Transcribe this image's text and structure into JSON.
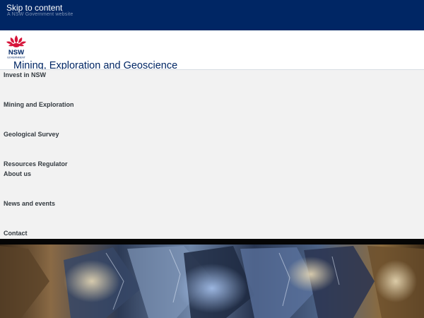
{
  "topbar": {
    "gov_text": "A NSW Government website",
    "skip_link": "Skip to content"
  },
  "header": {
    "logo_text": "NSW",
    "logo_subtext": "GOVERNMENT",
    "site_title": "Mining, Exploration and Geoscience"
  },
  "nav": {
    "items": [
      {
        "label": "Invest in NSW"
      },
      {
        "label": "Mining and Exploration"
      },
      {
        "label": "Geological Survey"
      },
      {
        "label": "Resources Regulator"
      },
      {
        "label": "About us"
      },
      {
        "label": "News and events"
      },
      {
        "label": "Contact"
      }
    ]
  },
  "colors": {
    "brand_navy": "#002664",
    "waratah_red": "#d7153a",
    "nav_background": "#f2f2f2"
  },
  "icons": [
    "nsw-waratah-logo"
  ]
}
